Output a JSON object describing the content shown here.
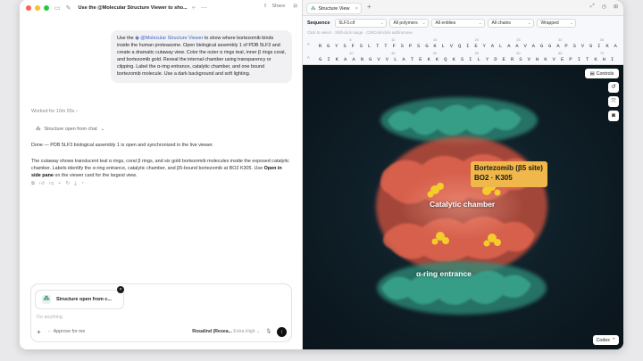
{
  "chat": {
    "title": "Use the @Molecular Structure Viewer to sho...",
    "share_label": "Share",
    "user_message_intro": "Use the ",
    "mention": "@Molecular Structure Viewer",
    "user_message_rest": " to show where bortezomib binds inside the human proteasome. Open biological assembly 1 of PDB 5LF3 and create a dramatic cutaway view. Color the outer α rings teal, inner β rings coral, and bortezomib gold. Reveal the internal chamber using transparency or clipping. Label the α-ring entrance, catalytic chamber, and one bound bortezomib molecule. Use a dark background and soft lighting.",
    "worked_for": "Worked for 10m 55s",
    "structure_chip": "Structure open from chat",
    "response_p1": "Done — PDB 5LF3 biological assembly 1 is open and synchronized in the live viewer.",
    "response_p2_a": "The cutaway shows translucent teal α rings, coral β rings, and six gold bortezomib molecules inside the exposed catalytic chamber. Labels identify the α-ring entrance, catalytic chamber, and β5-bound bortezomib at BO2 K305. Use ",
    "response_p2_bold": "Open in side pane",
    "response_p2_b": " on the viewer card for the largest view."
  },
  "composer": {
    "attachment_label": "Structure open from c...",
    "placeholder": "Do anything",
    "approve_label": "Approve for me",
    "model_name": "Rosalind (Resea...",
    "model_effort": "Extra High"
  },
  "viewer_tab": {
    "label": "Structure View"
  },
  "sequence": {
    "label": "Sequence",
    "file": "5LF3.cif",
    "polymers": "All polymers",
    "entities": "All entities",
    "chains": "All chains",
    "wrap": "Wrapped",
    "hint": "Click to select · Shift-click range · Ctrl/Cmd-click add/remove",
    "row1_chain": "A",
    "row1": [
      "R",
      "G",
      "Y",
      "S",
      "F",
      "S",
      "L",
      "T",
      "T",
      "F",
      "S",
      "P",
      "S",
      "G",
      "K",
      "L",
      "V",
      "Q",
      "I",
      "E",
      "Y",
      "A",
      "L",
      "A",
      "A",
      "V",
      "A",
      "G",
      "G",
      "A",
      "P",
      "S",
      "V",
      "G",
      "I",
      "K",
      "A"
    ],
    "row1_numbers": [
      "5",
      "10",
      "15",
      "20",
      "25",
      "30",
      "35"
    ],
    "row2_chain": "A",
    "row2": [
      "G",
      "I",
      "K",
      "A",
      "A",
      "N",
      "G",
      "V",
      "V",
      "L",
      "A",
      "T",
      "E",
      "K",
      "K",
      "Q",
      "K",
      "S",
      "I",
      "L",
      "Y",
      "D",
      "E",
      "R",
      "S",
      "V",
      "H",
      "K",
      "V",
      "E",
      "P",
      "I",
      "T",
      "K",
      "H",
      "I"
    ],
    "row2_numbers": [
      "40",
      "45",
      "50",
      "55",
      "60",
      "65",
      "70"
    ]
  },
  "viewer": {
    "controls_label": "Controls",
    "codex_label": "Codex",
    "label_bortezomib_line1": "Bortezomib (β5 site)",
    "label_bortezomib_line2": "BO2 · K305",
    "label_chamber": "Catalytic chamber",
    "label_entrance": "α-ring entrance"
  },
  "colors": {
    "alpha_ring": "#3aa88f",
    "beta_ring": "#e0654f",
    "bortezomib": "#f4cd2a",
    "label_bg": "#f0b84a",
    "background": "#0d1821"
  }
}
